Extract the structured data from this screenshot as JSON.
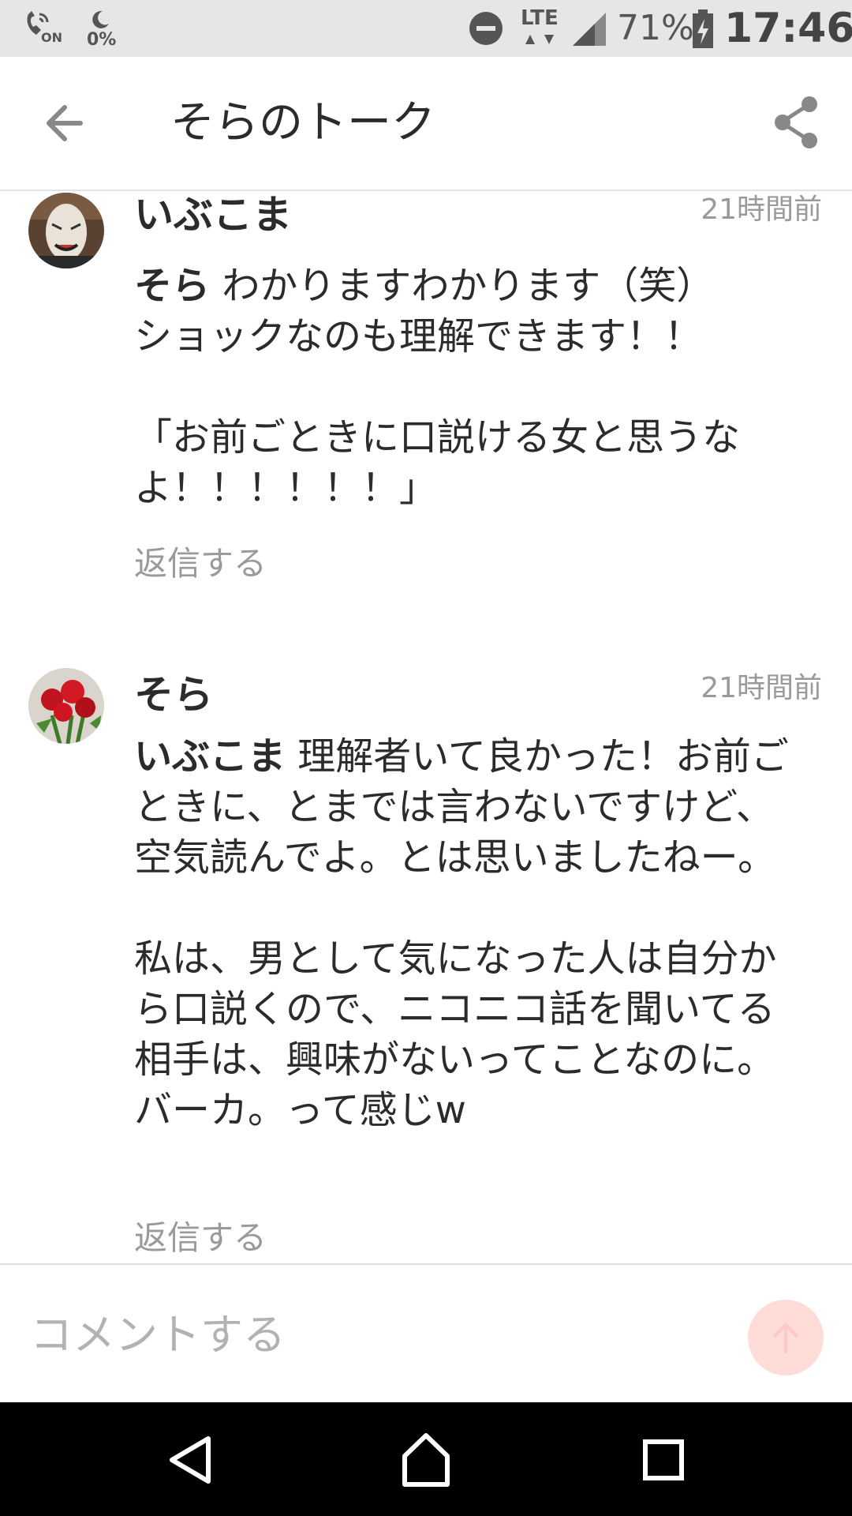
{
  "status_bar": {
    "on_label": "ON",
    "data_saver": "0%",
    "network": "LTE",
    "battery": "71%",
    "time": "17:46"
  },
  "header": {
    "title": "そらのトーク",
    "back_icon": "arrow-left-icon",
    "share_icon": "share-icon"
  },
  "comments": [
    {
      "author": "いぶこま",
      "time": "21時間前",
      "mention": "そら",
      "body": " わかりますわかります（笑）\nショックなのも理解できます！！\n\n「お前ごときに口説ける女と思うなよ！！！！！！」",
      "reply_label": "返信する",
      "avatar_icon": "mask-avatar"
    },
    {
      "author": "そら",
      "time": "21時間前",
      "mention": "いぶこま",
      "body": " 理解者いて良かった！お前ごときに、とまでは言わないですけど、空気読んでよ。とは思いましたねー。\n\n私は、男として気になった人は自分から口説くので、ニコニコ話を聞いてる相手は、興味がないってことなのに。バーカ。って感じw",
      "reply_label": "返信する",
      "avatar_icon": "roses-avatar"
    }
  ],
  "composer": {
    "placeholder": "コメントする",
    "send_icon": "arrow-up-icon",
    "send_color": "#ffdcd8"
  },
  "nav": {
    "back_icon": "triangle-back-icon",
    "home_icon": "home-icon",
    "recents_icon": "square-recents-icon"
  }
}
